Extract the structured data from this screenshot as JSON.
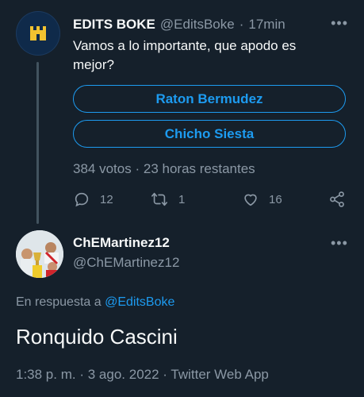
{
  "tweet": {
    "author_name": "EDITS BOKE",
    "author_handle": "@EditsBoke",
    "separator": "·",
    "time": "17min",
    "text": "Vamos a lo importante, que apodo es mejor?",
    "poll": {
      "options": [
        "Raton Bermudez",
        "Chicho Siesta"
      ],
      "votes": "384 votos",
      "separator": "·",
      "time_left": "23 horas restantes"
    },
    "actions": {
      "reply_icon": "reply-icon",
      "reply_count": "12",
      "retweet_icon": "retweet-icon",
      "retweet_count": "1",
      "like_icon": "heart-icon",
      "like_count": "16",
      "share_icon": "share-icon"
    }
  },
  "reply": {
    "author_name": "ChEMartinez12",
    "author_handle": "@ChEMartinez12",
    "in_reply_prefix": "En respuesta a",
    "in_reply_handle": "@EditsBoke",
    "text": "Ronquido Cascini",
    "timestamp": "1:38 p. m.",
    "date": "3 ago. 2022",
    "source": "Twitter Web App",
    "separator": "·"
  },
  "colors": {
    "background": "#15202b",
    "accent": "#1d9bf0",
    "secondary_text": "#8b98a5",
    "primary_text": "#f7f9f9",
    "logo_gold": "#f2c230"
  }
}
